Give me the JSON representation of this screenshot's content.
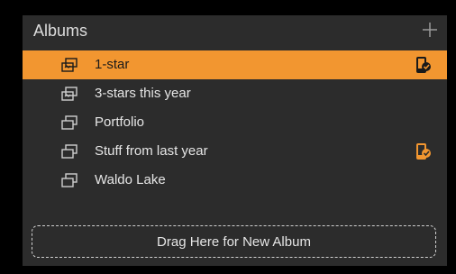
{
  "header": {
    "title": "Albums",
    "add_icon": "plus-icon"
  },
  "albums": [
    {
      "label": "1-star",
      "icon": "smart-album-icon",
      "selected": true,
      "synced": true
    },
    {
      "label": "3-stars this year",
      "icon": "smart-album-icon",
      "selected": false,
      "synced": false
    },
    {
      "label": "Portfolio",
      "icon": "album-icon",
      "selected": false,
      "synced": false
    },
    {
      "label": "Stuff from last year",
      "icon": "album-icon",
      "selected": false,
      "synced": true
    },
    {
      "label": "Waldo Lake",
      "icon": "album-icon",
      "selected": false,
      "synced": false
    }
  ],
  "dropzone": {
    "label": "Drag Here for New Album"
  },
  "colors": {
    "accent": "#f29630",
    "panel": "#2c2c2c",
    "sync_badge": "#f29630"
  }
}
